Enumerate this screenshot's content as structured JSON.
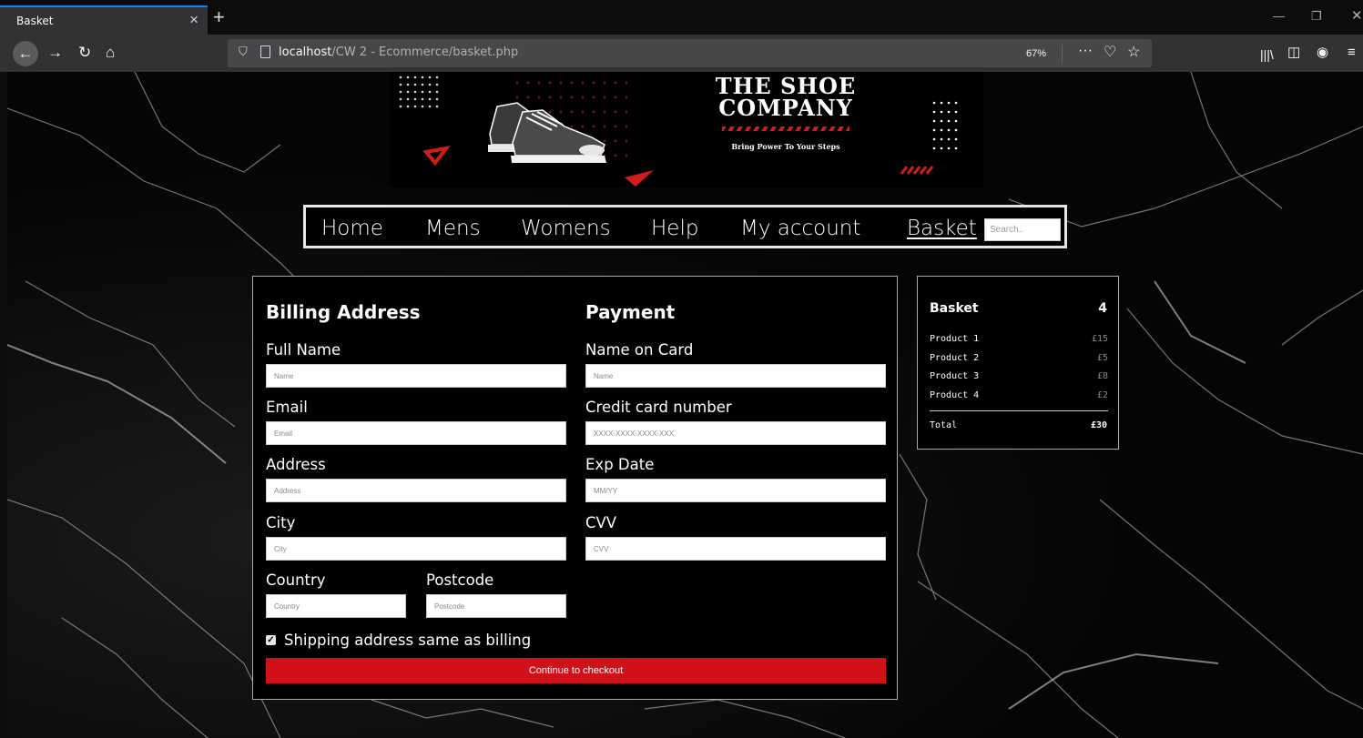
{
  "browser": {
    "tab_title": "Basket",
    "tab_close": "×",
    "new_tab": "+",
    "url_host": "localhost",
    "url_path": "/CW 2 - Ecommerce/basket.php",
    "zoom": "67%",
    "page_actions": "···",
    "icons": [
      "back-icon",
      "forward-icon",
      "reload-icon",
      "home-icon",
      "shield-icon",
      "page-icon",
      "pocket-icon",
      "star-icon",
      "library-icon",
      "sidebar-icon",
      "account-icon",
      "menu-icon"
    ]
  },
  "banner": {
    "title_line1": "THE SHOE",
    "title_line2": "COMPANY",
    "tagline": "Bring Power To Your Steps",
    "accent_color": "#d21c1c"
  },
  "nav": {
    "items": [
      {
        "label": "Home"
      },
      {
        "label": "Mens"
      },
      {
        "label": "Womens"
      },
      {
        "label": "Help"
      },
      {
        "label": "My account"
      },
      {
        "label": "Basket",
        "active": true
      }
    ],
    "search_placeholder": "Search.."
  },
  "billing": {
    "heading": "Billing Address",
    "full_name": {
      "label": "Full Name",
      "placeholder": "Name"
    },
    "email": {
      "label": "Email",
      "placeholder": "Email"
    },
    "address": {
      "label": "Address",
      "placeholder": "Address"
    },
    "city": {
      "label": "City",
      "placeholder": "City"
    },
    "country": {
      "label": "Country",
      "placeholder": "Country"
    },
    "postcode": {
      "label": "Postcode",
      "placeholder": "Postcode"
    }
  },
  "payment": {
    "heading": "Payment",
    "name_on_card": {
      "label": "Name on Card",
      "placeholder": "Name"
    },
    "card_number": {
      "label": "Credit card number",
      "placeholder": "XXXX-XXXX-XXXX-XXX"
    },
    "exp_date": {
      "label": "Exp Date",
      "placeholder": "MM/YY"
    },
    "cvv": {
      "label": "CVV",
      "placeholder": "CVV"
    }
  },
  "shipping_same": {
    "label": "Shipping address same as billing",
    "checked": true
  },
  "checkout_button": "Continue to checkout",
  "checkout_color": "#d0111a",
  "basket": {
    "title": "Basket",
    "count": "4",
    "items": [
      {
        "name": "Product 1",
        "price": "£15"
      },
      {
        "name": "Product 2",
        "price": "£5"
      },
      {
        "name": "Product 3",
        "price": "£8"
      },
      {
        "name": "Product 4",
        "price": "£2"
      }
    ],
    "total_label": "Total",
    "total_value": "£30"
  }
}
